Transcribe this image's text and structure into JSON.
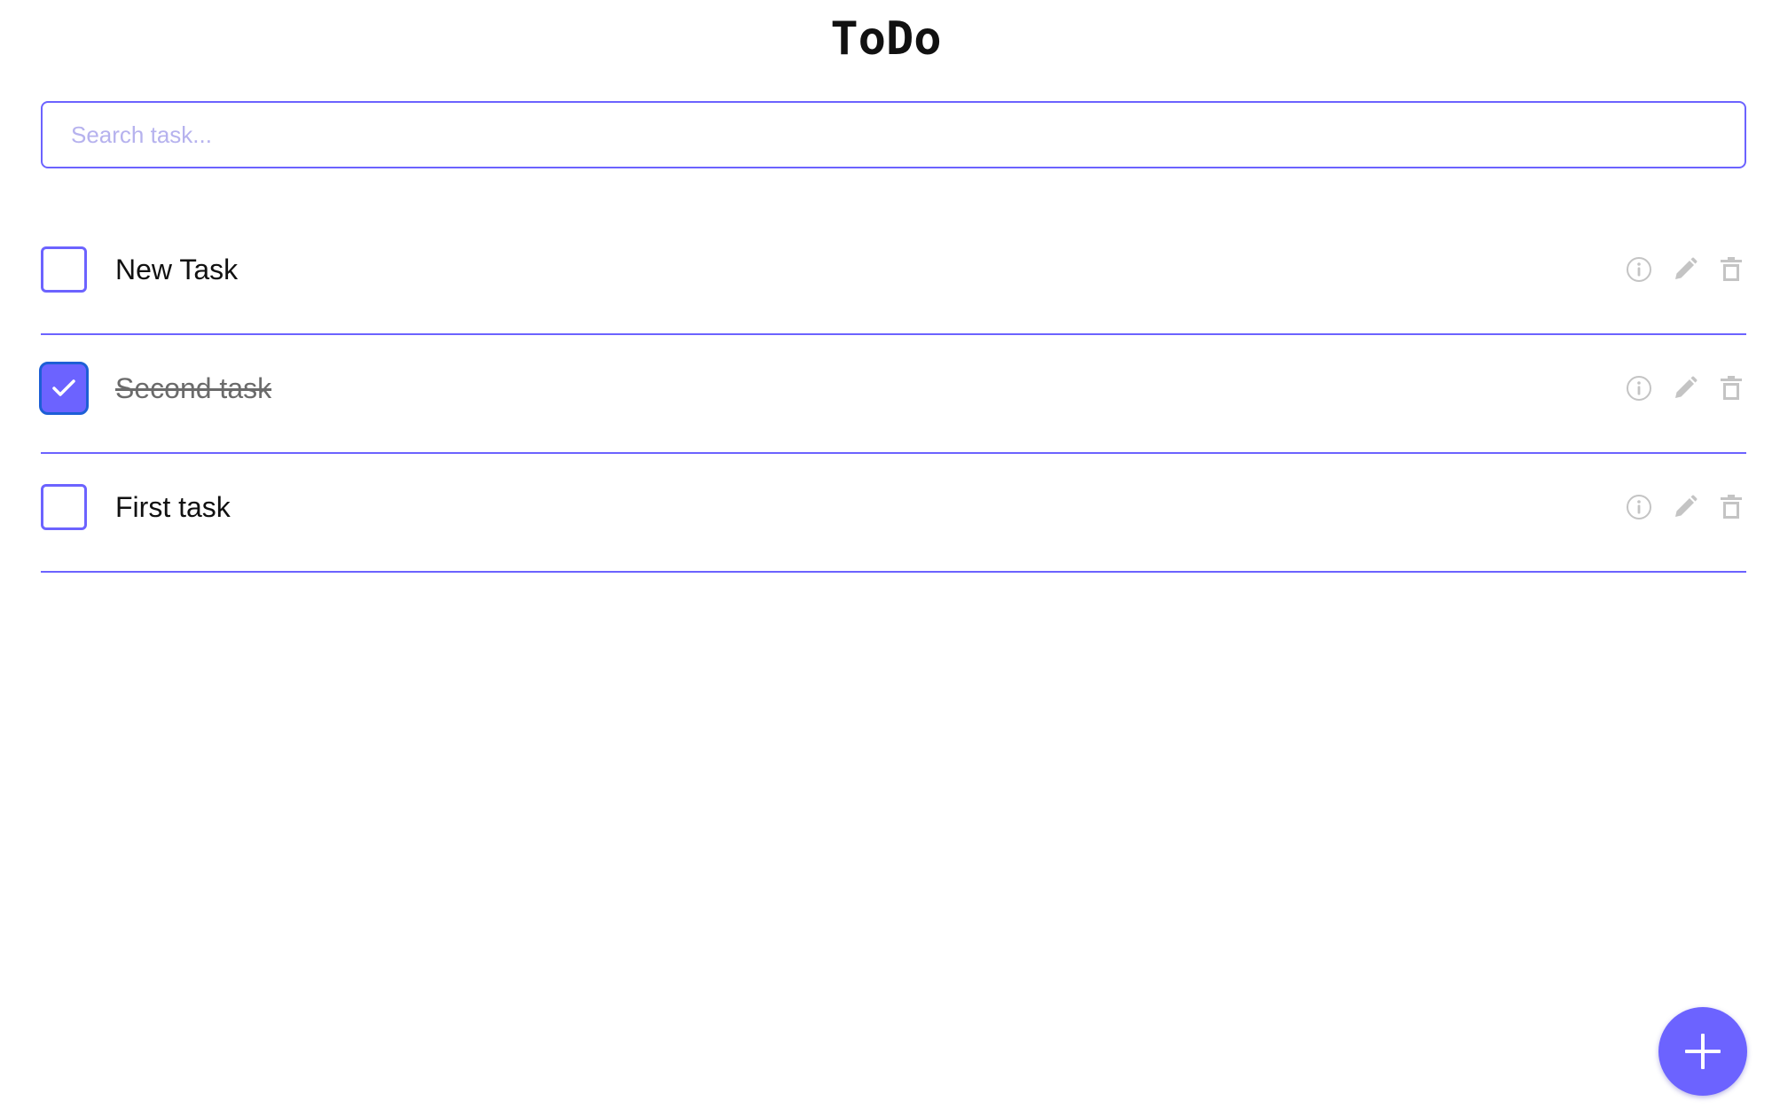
{
  "app": {
    "title": "ToDo"
  },
  "search": {
    "placeholder": "Search task...",
    "value": ""
  },
  "tasks": [
    {
      "label": "New Task",
      "completed": false
    },
    {
      "label": "Second task",
      "completed": true
    },
    {
      "label": "First task",
      "completed": false
    }
  ],
  "icons": {
    "info": "info-icon",
    "edit": "pencil-icon",
    "delete": "trash-icon",
    "check": "checkmark-icon",
    "add": "plus-icon"
  },
  "colors": {
    "accent": "#6c63ff",
    "checkbox_border_checked": "#1d5fd6",
    "icon_gray": "#c4c4c4",
    "completed_text": "#6b6b6b",
    "placeholder": "#b6b2ee"
  }
}
